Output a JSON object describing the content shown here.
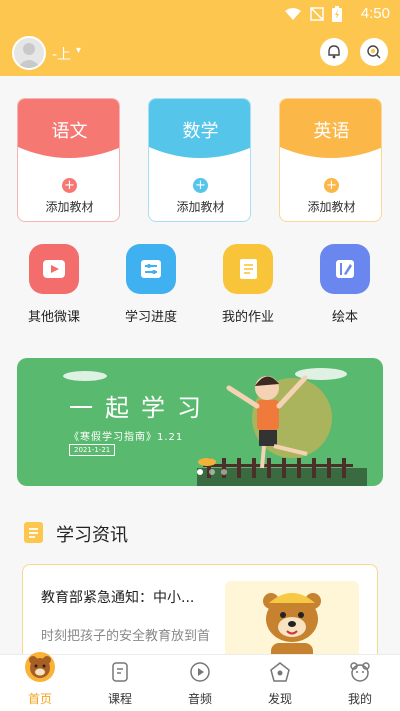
{
  "status_bar": {
    "time": "4:50"
  },
  "header": {
    "user_name": "-上",
    "caret": "▾"
  },
  "subjects": [
    {
      "title": "语文",
      "add_label": "添加教材",
      "color": "#f57873"
    },
    {
      "title": "数学",
      "add_label": "添加教材",
      "color": "#55c5ea"
    },
    {
      "title": "英语",
      "add_label": "添加教材",
      "color": "#fbb748"
    }
  ],
  "features": [
    {
      "label": "其他微课",
      "icon": "video-play-icon",
      "color": "#f46d6d"
    },
    {
      "label": "学习进度",
      "icon": "progress-sliders-icon",
      "color": "#3fb0f0"
    },
    {
      "label": "我的作业",
      "icon": "notebook-icon",
      "color": "#f8c53a"
    },
    {
      "label": "绘本",
      "icon": "picture-book-icon",
      "color": "#6a86ef"
    }
  ],
  "banner": {
    "title": "一起学习",
    "subtitle": "《寒假学习指南》1.21",
    "date": "2021-1-21",
    "page_count": 3,
    "current_page": 1
  },
  "news_section": {
    "title": "学习资讯",
    "items": [
      {
        "title": "教育部紧急通知：中小...",
        "desc": "时刻把孩子的安全教育放到首"
      }
    ]
  },
  "tabbar": {
    "items": [
      {
        "label": "首页",
        "icon": "bear-home-icon",
        "active": true
      },
      {
        "label": "课程",
        "icon": "course-icon",
        "active": false
      },
      {
        "label": "音频",
        "icon": "audio-icon",
        "active": false
      },
      {
        "label": "发现",
        "icon": "discover-icon",
        "active": false
      },
      {
        "label": "我的",
        "icon": "profile-icon",
        "active": false
      }
    ]
  },
  "colors": {
    "accent": "#fcc64f",
    "active_tab": "#f2a51b",
    "banner_bg": "#59ba6f"
  }
}
